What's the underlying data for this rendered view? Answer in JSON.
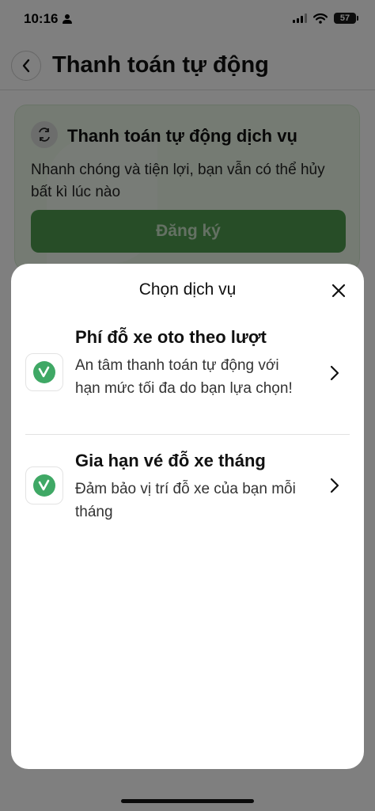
{
  "status_bar": {
    "time": "10:16",
    "battery": "57"
  },
  "header": {
    "title": "Thanh toán tự động"
  },
  "promo": {
    "title": "Thanh toán tự động dịch vụ",
    "description": "Nhanh chóng và tiện lợi, bạn vẫn có thể hủy bất kì lúc nào",
    "register_label": "Đăng ký"
  },
  "sheet": {
    "title": "Chọn dịch vụ",
    "services": [
      {
        "title": "Phí đỗ xe oto theo lượt",
        "description": "An tâm thanh toán tự động với hạn mức tối đa do bạn lựa chọn!"
      },
      {
        "title": "Gia hạn vé đỗ xe tháng",
        "description": "Đảm bảo vị trí đỗ xe của bạn mỗi tháng"
      }
    ]
  },
  "colors": {
    "brand_green": "#3fa865",
    "button_green": "#4f9a4f",
    "promo_bg": "#eaf6e6"
  }
}
